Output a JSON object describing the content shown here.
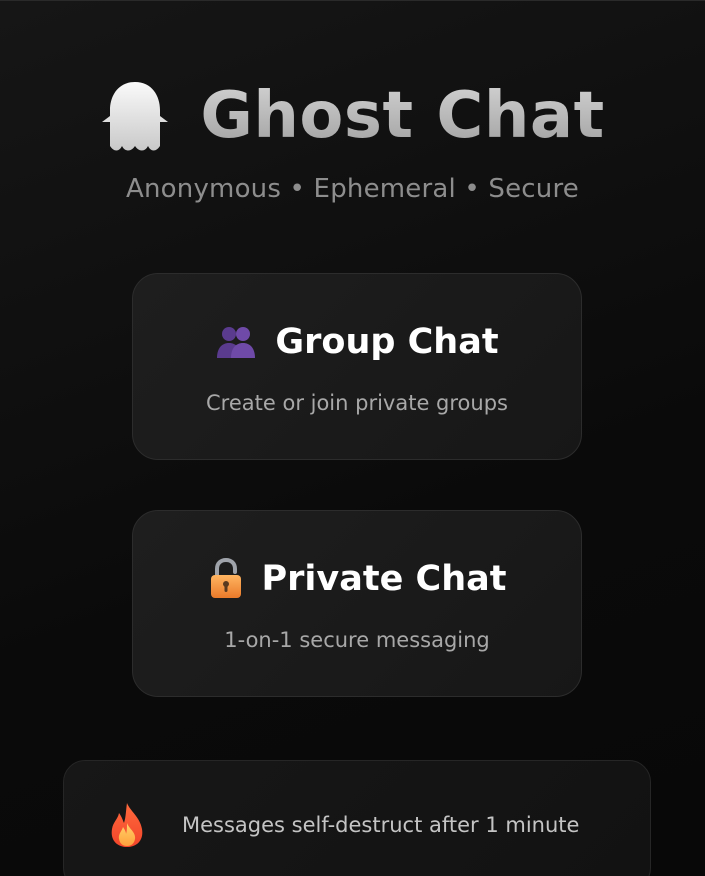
{
  "app": {
    "title": "Ghost Chat",
    "tagline": "Anonymous • Ephemeral • Secure",
    "logo_icon": "ghost-icon"
  },
  "options": [
    {
      "id": "group",
      "icon": "two-people-icon",
      "title": "Group Chat",
      "description": "Create or join private groups"
    },
    {
      "id": "private",
      "icon": "lock-icon",
      "title": "Private Chat",
      "description": "1-on-1 secure messaging"
    }
  ],
  "notice": {
    "icon": "fire-icon",
    "text": "Messages self-destruct after 1 minute"
  },
  "colors": {
    "background": "#0a0a0a",
    "card": "#1a1a1a",
    "card_border": "#2c2c2c",
    "title_gradient_top": "#d8d8d8",
    "title_gradient_bottom": "#9a9a9a",
    "accent_purple": "#5b3a8c",
    "accent_orange": "#f08a2c"
  }
}
